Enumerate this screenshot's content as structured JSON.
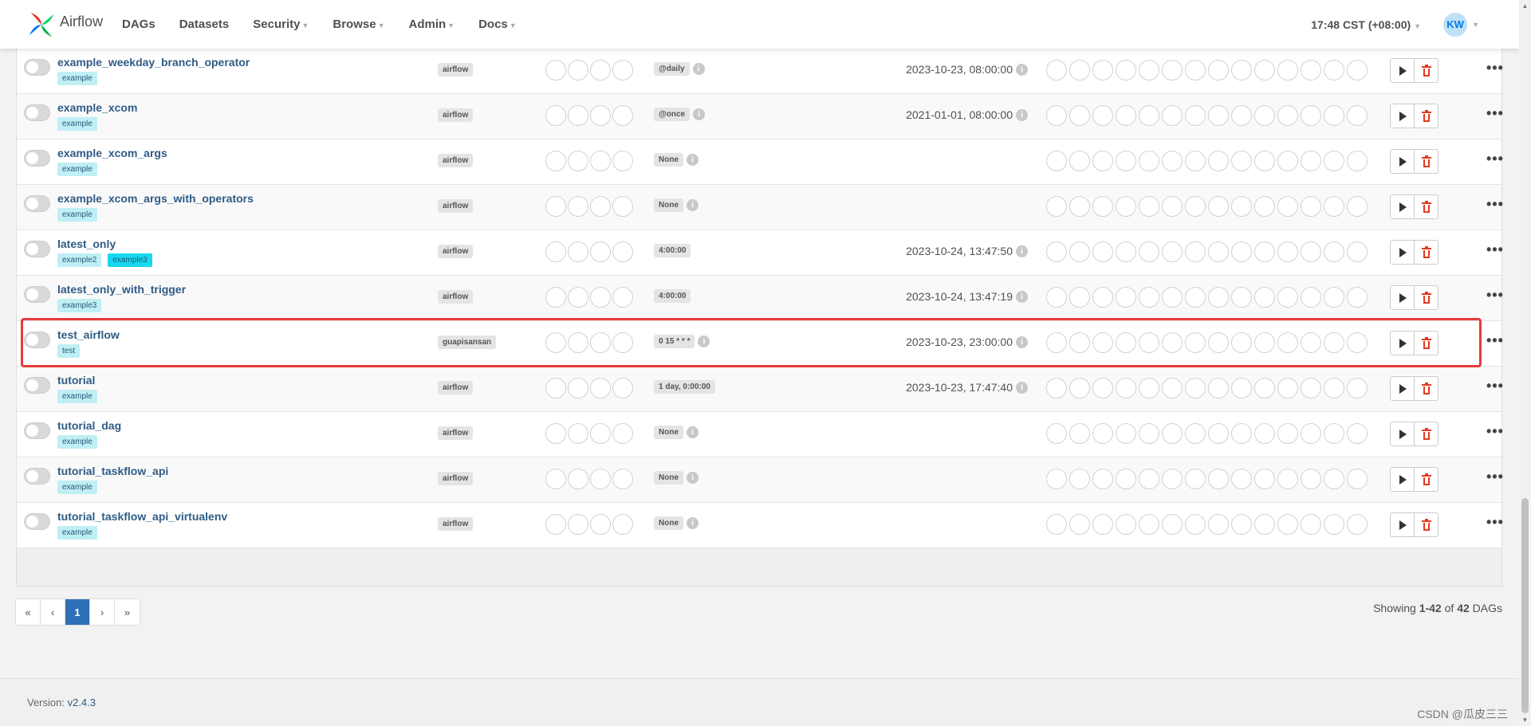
{
  "header": {
    "brand": "Airflow",
    "nav": [
      {
        "label": "DAGs",
        "has_dropdown": false
      },
      {
        "label": "Datasets",
        "has_dropdown": false
      },
      {
        "label": "Security",
        "has_dropdown": true
      },
      {
        "label": "Browse",
        "has_dropdown": true
      },
      {
        "label": "Admin",
        "has_dropdown": true
      },
      {
        "label": "Docs",
        "has_dropdown": true
      }
    ],
    "clock": "17:48 CST (+08:00)",
    "avatar": "KW"
  },
  "icons": {
    "info": "info-icon",
    "trigger": "play-icon",
    "delete": "trash-icon",
    "more": "ellipsis-icon",
    "caret": "chevron-down-icon"
  },
  "dags": [
    {
      "name": "example_weekday_branch_operator",
      "tags": [
        "example"
      ],
      "owner": "airflow",
      "schedule": "@daily",
      "schedule_info": true,
      "next_run": "2023-10-23, 08:00:00"
    },
    {
      "name": "example_xcom",
      "tags": [
        "example"
      ],
      "owner": "airflow",
      "schedule": "@once",
      "schedule_info": true,
      "next_run": "2021-01-01, 08:00:00"
    },
    {
      "name": "example_xcom_args",
      "tags": [
        "example"
      ],
      "owner": "airflow",
      "schedule": "None",
      "schedule_info": true,
      "next_run": ""
    },
    {
      "name": "example_xcom_args_with_operators",
      "tags": [
        "example"
      ],
      "owner": "airflow",
      "schedule": "None",
      "schedule_info": true,
      "next_run": ""
    },
    {
      "name": "latest_only",
      "tags": [
        "example2",
        "example3"
      ],
      "active_tag": "example3",
      "owner": "airflow",
      "schedule": "4:00:00",
      "schedule_info": false,
      "next_run": "2023-10-24, 13:47:50"
    },
    {
      "name": "latest_only_with_trigger",
      "tags": [
        "example3"
      ],
      "owner": "airflow",
      "schedule": "4:00:00",
      "schedule_info": false,
      "next_run": "2023-10-24, 13:47:19"
    },
    {
      "name": "test_airflow",
      "tags": [
        "test"
      ],
      "owner": "guapisansan",
      "schedule": "0 15 * * *",
      "schedule_info": true,
      "next_run": "2023-10-23, 23:00:00",
      "highlighted": true
    },
    {
      "name": "tutorial",
      "tags": [
        "example"
      ],
      "owner": "airflow",
      "schedule": "1 day, 0:00:00",
      "schedule_info": false,
      "next_run": "2023-10-23, 17:47:40"
    },
    {
      "name": "tutorial_dag",
      "tags": [
        "example"
      ],
      "owner": "airflow",
      "schedule": "None",
      "schedule_info": true,
      "next_run": ""
    },
    {
      "name": "tutorial_taskflow_api",
      "tags": [
        "example"
      ],
      "owner": "airflow",
      "schedule": "None",
      "schedule_info": true,
      "next_run": ""
    },
    {
      "name": "tutorial_taskflow_api_virtualenv",
      "tags": [
        "example"
      ],
      "owner": "airflow",
      "schedule": "None",
      "schedule_info": true,
      "next_run": ""
    }
  ],
  "run_circles": 4,
  "recent_task_circles": 14,
  "pagination": {
    "first": "«",
    "prev": "‹",
    "current": "1",
    "next": "›",
    "last": "»"
  },
  "showing": {
    "prefix": "Showing ",
    "range": "1-42",
    "of": " of ",
    "total": "42",
    "suffix": " DAGs"
  },
  "footer": {
    "version_label": "Version: ",
    "version": "v2.4.3",
    "watermark": "CSDN @瓜皮三三"
  },
  "colors": {
    "link": "#2f5b86",
    "tag_bg": "#bfeff4",
    "tag_active_bg": "#16d9ee",
    "highlight": "#e63b3b",
    "delete_red": "#e43921",
    "page_active": "#2d70b8"
  }
}
